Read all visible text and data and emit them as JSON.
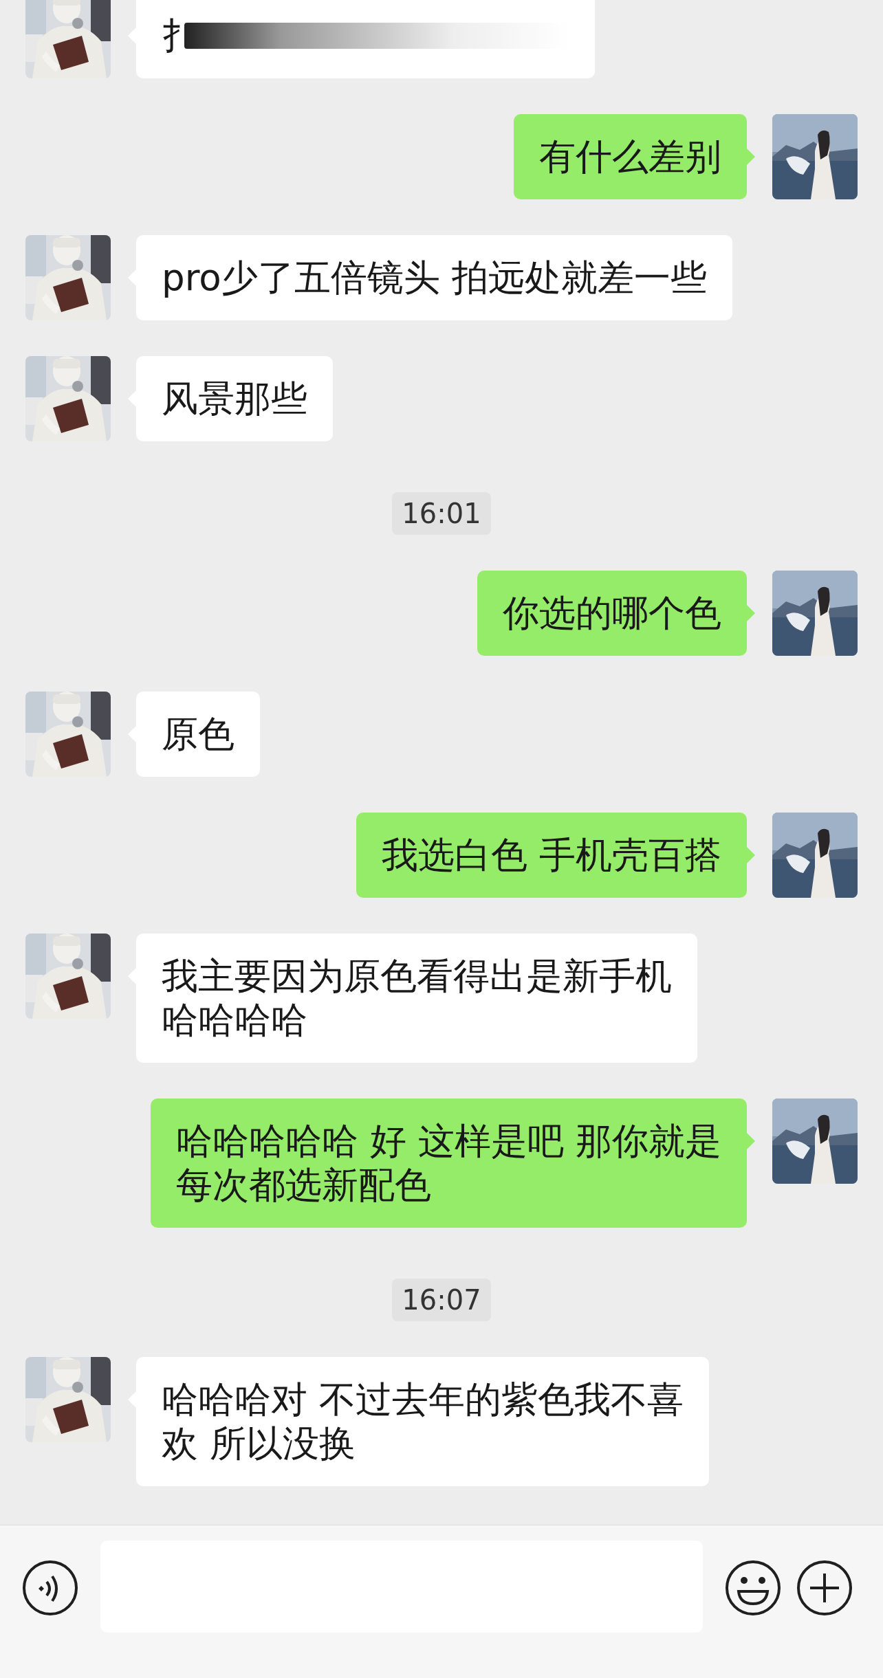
{
  "messages": [
    {
      "kind": "incoming",
      "lines": [
        "扌"
      ],
      "redacted": true
    },
    {
      "kind": "outgoing",
      "lines": [
        "有什么差别"
      ],
      "redacted": false
    },
    {
      "kind": "incoming",
      "lines": [
        "pro少了五倍镜头 拍远处就差一些"
      ],
      "redacted": false
    },
    {
      "kind": "incoming",
      "lines": [
        "风景那些"
      ],
      "redacted": false
    },
    {
      "kind": "time",
      "text": "16:01"
    },
    {
      "kind": "outgoing",
      "lines": [
        "你选的哪个色"
      ],
      "redacted": false
    },
    {
      "kind": "incoming",
      "lines": [
        "原色"
      ],
      "redacted": false
    },
    {
      "kind": "outgoing",
      "lines": [
        "我选白色 手机壳百搭"
      ],
      "redacted": false
    },
    {
      "kind": "incoming",
      "lines": [
        "我主要因为原色看得出是新手机",
        "哈哈哈哈"
      ],
      "redacted": false
    },
    {
      "kind": "outgoing",
      "lines": [
        "哈哈哈哈哈 好 这样是吧 那你就是",
        "每次都选新配色"
      ],
      "redacted": false
    },
    {
      "kind": "time",
      "text": "16:07"
    },
    {
      "kind": "incoming",
      "lines": [
        "哈哈哈对 不过去年的紫色我不喜",
        "欢 所以没换"
      ],
      "redacted": false
    }
  ]
}
